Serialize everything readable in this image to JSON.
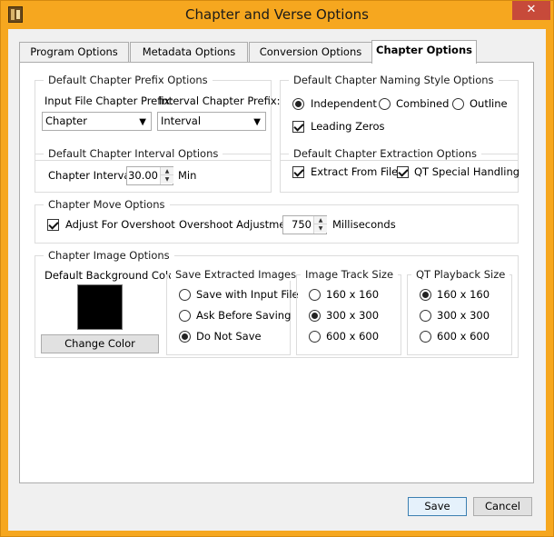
{
  "window": {
    "title": "Chapter and Verse Options",
    "close_glyph": "✕"
  },
  "tabs": [
    {
      "label": "Program Options",
      "active": false
    },
    {
      "label": "Metadata Options",
      "active": false
    },
    {
      "label": "Conversion Options",
      "active": false
    },
    {
      "label": "Chapter Options",
      "active": true
    }
  ],
  "prefix_group": {
    "title": "Default Chapter Prefix Options",
    "input_label": "Input File Chapter Prefix:",
    "input_value": "Chapter",
    "interval_label": "Interval Chapter Prefix:",
    "interval_value": "Interval"
  },
  "naming_group": {
    "title": "Default Chapter Naming Style Options",
    "options": [
      {
        "label": "Independent",
        "selected": true
      },
      {
        "label": "Combined",
        "selected": false
      },
      {
        "label": "Outline",
        "selected": false
      }
    ],
    "leading_zeros_label": "Leading Zeros",
    "leading_zeros_checked": true
  },
  "interval_group": {
    "title": "Default Chapter Interval Options",
    "label": "Chapter Interval:",
    "value": "30.00",
    "unit": "Min"
  },
  "extraction_group": {
    "title": "Default Chapter Extraction Options",
    "extract_label": "Extract From Files",
    "extract_checked": true,
    "qt_label": "QT Special Handling",
    "qt_checked": true
  },
  "move_group": {
    "title": "Chapter Move Options",
    "adjust_label": "Adjust For Overshoot",
    "adjust_checked": true,
    "overshoot_label": "Overshoot Adjustment:",
    "overshoot_value": "750",
    "overshoot_unit": "Milliseconds"
  },
  "image_group": {
    "title": "Chapter Image Options",
    "bg_label": "Default Background Color:",
    "bg_color": "#000000",
    "change_color_label": "Change Color",
    "save_images": {
      "title": "Save Extracted Images",
      "options": [
        {
          "label": "Save with Input File",
          "selected": false
        },
        {
          "label": "Ask Before Saving",
          "selected": false
        },
        {
          "label": "Do Not Save",
          "selected": true
        }
      ]
    },
    "track_size": {
      "title": "Image Track Size",
      "options": [
        {
          "label": "160 x 160",
          "selected": false
        },
        {
          "label": "300 x 300",
          "selected": true
        },
        {
          "label": "600 x 600",
          "selected": false
        }
      ]
    },
    "qt_size": {
      "title": "QT Playback Size",
      "options": [
        {
          "label": "160 x 160",
          "selected": true
        },
        {
          "label": "300 x 300",
          "selected": false
        },
        {
          "label": "600 x 600",
          "selected": false
        }
      ]
    }
  },
  "footer": {
    "save_label": "Save",
    "cancel_label": "Cancel"
  },
  "colors": {
    "titlebar": "#f6a71f",
    "close": "#c74a3a",
    "dialog_bg": "#f0f0f0"
  }
}
